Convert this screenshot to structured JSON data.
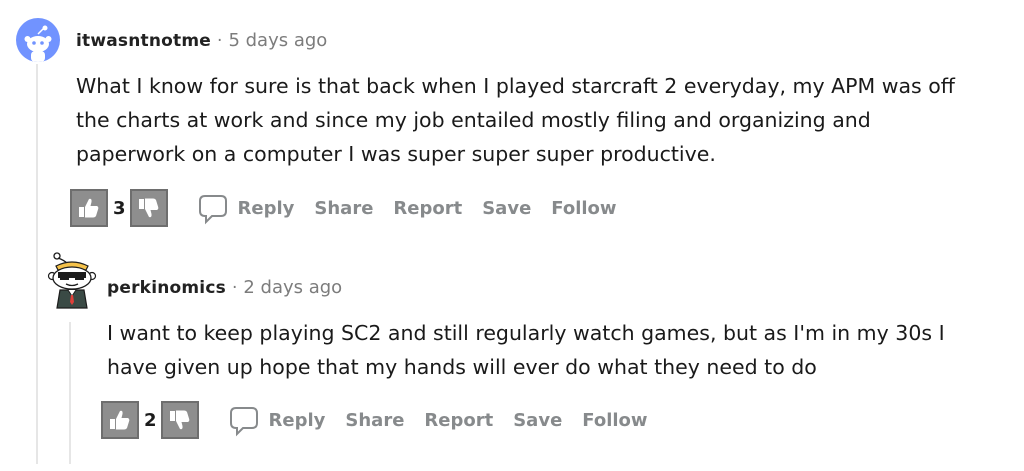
{
  "comments": [
    {
      "username": "itwasntnotme",
      "separator": "·",
      "time": "5 days ago",
      "lines": [
        "What I know for sure is that back when I played starcraft 2 everyday, my APM was off",
        "the charts at work and since my job entailed mostly filing and organizing and",
        "paperwork on a computer I was super super super productive."
      ],
      "score": "3",
      "actions": {
        "reply": "Reply",
        "share": "Share",
        "report": "Report",
        "save": "Save",
        "follow": "Follow"
      }
    },
    {
      "username": "perkinomics",
      "separator": "·",
      "time": "2 days ago",
      "lines": [
        "I want to keep playing SC2 and still regularly watch games, but as I'm in my 30s I",
        "have given up hope that my hands will ever do what they need to do"
      ],
      "score": "2",
      "actions": {
        "reply": "Reply",
        "share": "Share",
        "report": "Report",
        "save": "Save",
        "follow": "Follow"
      }
    }
  ],
  "icons": {
    "upvote": "thumbs-up-icon",
    "downvote": "thumbs-down-icon",
    "reply": "speech-bubble-icon",
    "avatar1": "snoo-avatar-icon",
    "avatar2": "snoo-sunglasses-avatar-icon"
  },
  "colors": {
    "avatar1_bg": "#7193ff",
    "action_text": "#878a8c",
    "vote_bg": "#8e8e8e"
  }
}
